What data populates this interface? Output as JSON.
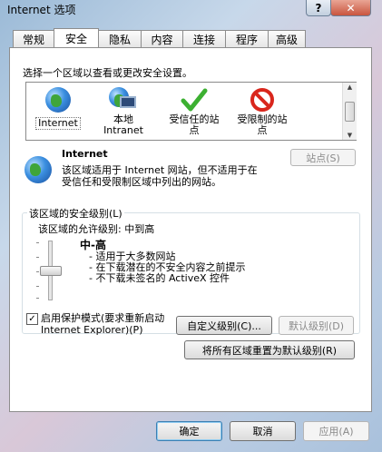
{
  "window": {
    "title": "Internet 选项",
    "help_label": "?",
    "close_label": "✕"
  },
  "tabs": [
    {
      "label": "常规"
    },
    {
      "label": "安全"
    },
    {
      "label": "隐私"
    },
    {
      "label": "内容"
    },
    {
      "label": "连接"
    },
    {
      "label": "程序"
    },
    {
      "label": "高级"
    }
  ],
  "active_tab": "安全",
  "security": {
    "prompt": "选择一个区域以查看或更改安全设置。",
    "zones": [
      {
        "line1": "Internet",
        "line2": "",
        "icon": "globe-icon"
      },
      {
        "line1": "本地",
        "line2": "Intranet",
        "icon": "local-intranet-icon"
      },
      {
        "line1": "受信任的站",
        "line2": "点",
        "icon": "green-check-icon"
      },
      {
        "line1": "受限制的站",
        "line2": "点",
        "icon": "restricted-circle-icon"
      }
    ],
    "selected_zone": {
      "name": "Internet",
      "description_line1": "该区域适用于 Internet 网站，但不适用于在",
      "description_line2": "受信任和受限制区域中列出的网站。",
      "sites_button": "站点(S)"
    },
    "level_group": {
      "title": "该区域的安全级别(L)",
      "allowed_label": "该区域的允许级别: 中到高",
      "level_name": "中-高",
      "bullets": [
        "- 适用于大多数网站",
        "- 在下载潜在的不安全内容之前提示",
        "- 不下载未签名的 ActiveX 控件"
      ],
      "protected_mode_line1": "启用保护模式(要求重新启动",
      "protected_mode_line2": "Internet Explorer)(P)",
      "protected_mode_checked": true,
      "custom_level_button": "自定义级别(C)...",
      "default_level_button": "默认级别(D)"
    },
    "reset_all_button": "将所有区域重置为默认级别(R)"
  },
  "footer": {
    "ok": "确定",
    "cancel": "取消",
    "apply": "应用(A)"
  },
  "colors": {
    "accent": "#3399ff",
    "check": "#3cb031",
    "restricted": "#d9261c"
  }
}
